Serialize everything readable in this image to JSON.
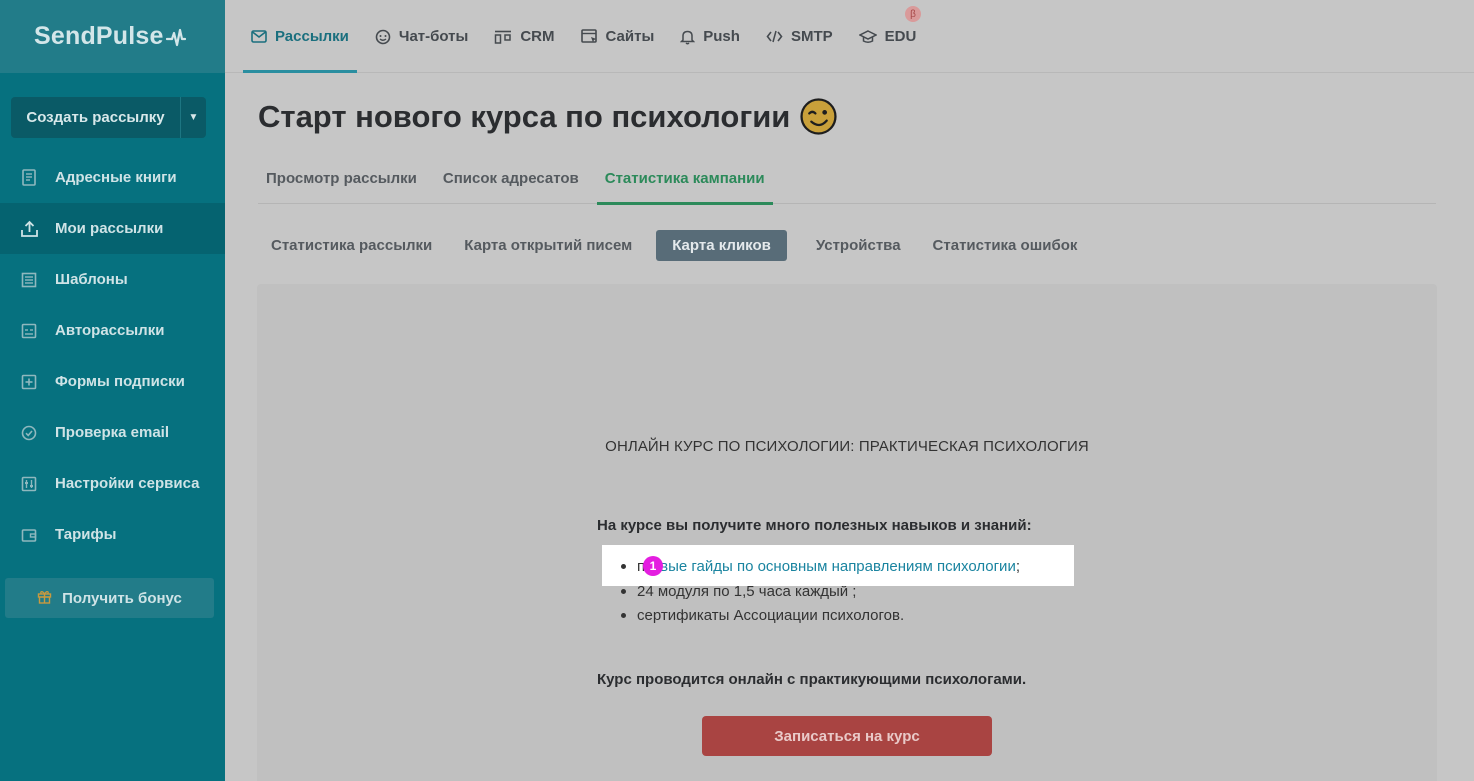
{
  "brand": {
    "logo_text": "SendPulse"
  },
  "sidebar": {
    "create_button": "Создать рассылку",
    "items": [
      {
        "label": "Адресные книги",
        "icon": "address-book-icon"
      },
      {
        "label": "Мои рассылки",
        "icon": "campaigns-icon",
        "active": true
      },
      {
        "label": "Шаблоны",
        "icon": "templates-icon"
      },
      {
        "label": "Авторассылки",
        "icon": "automation-icon"
      },
      {
        "label": "Формы подписки",
        "icon": "subscription-form-icon"
      },
      {
        "label": "Проверка email",
        "icon": "email-verify-icon"
      },
      {
        "label": "Настройки сервиса",
        "icon": "settings-icon"
      },
      {
        "label": "Тарифы",
        "icon": "wallet-icon"
      }
    ],
    "bonus_button": "Получить бонус"
  },
  "topnav": {
    "items": [
      {
        "label": "Рассылки",
        "icon": "envelope-icon",
        "active": true
      },
      {
        "label": "Чат-боты",
        "icon": "chatbot-icon"
      },
      {
        "label": "CRM",
        "icon": "crm-icon"
      },
      {
        "label": "Сайты",
        "icon": "site-icon"
      },
      {
        "label": "Push",
        "icon": "bell-icon"
      },
      {
        "label": "SMTP",
        "icon": "code-icon"
      },
      {
        "label": "EDU",
        "icon": "graduation-cap-icon"
      }
    ],
    "beta_badge": "β"
  },
  "page": {
    "title": "Старт нового курса по психологии",
    "tabs": [
      "Просмотр рассылки",
      "Список адресатов",
      "Статистика кампании"
    ],
    "active_tab": 2,
    "subtabs": [
      "Статистика рассылки",
      "Карта открытий писем",
      "Карта кликов",
      "Устройства",
      "Статистика ошибок"
    ],
    "active_subtab": 2
  },
  "email_preview": {
    "heading": "ОНЛАЙН КУРС ПО ПСИХОЛОГИИ: ПРАКТИЧЕСКАЯ ПСИХОЛОГИЯ",
    "intro": "На курсе вы получите много полезных навыков и знаний:",
    "bullets": [
      {
        "prefix": "п",
        "link": "олезные гайды по основным направлениям психологии",
        "link_visible": "вые гайды по основным направлениям психологии",
        "suffix": ";"
      },
      {
        "text": "24 модуля по 1,5 часа каждый ;"
      },
      {
        "text": "сертификаты Ассоциации психологов."
      }
    ],
    "click_badge": "1",
    "note": "Курс проводится онлайн с практикующими психологами.",
    "cta": "Записаться на курс"
  },
  "colors": {
    "sidebar": "#06717f",
    "accent_green": "#2c8a5a",
    "active_subtab": "#586c78",
    "cta": "#a94442",
    "click_badge": "#e41ee0"
  }
}
